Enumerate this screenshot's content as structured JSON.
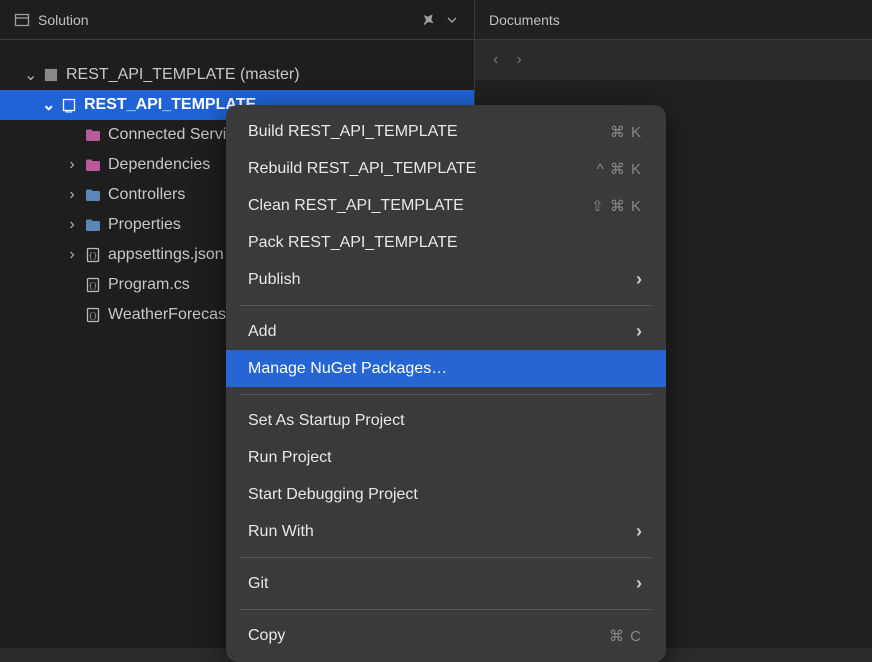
{
  "panels": {
    "solution": {
      "title": "Solution"
    },
    "documents": {
      "title": "Documents"
    }
  },
  "tree": {
    "solution": {
      "label": "REST_API_TEMPLATE (master)"
    },
    "project": {
      "label": "REST_API_TEMPLATE"
    },
    "items": [
      {
        "label": "Connected Services",
        "iconKind": "folder-pink",
        "caret": ""
      },
      {
        "label": "Dependencies",
        "iconKind": "folder-pink",
        "caret": "›"
      },
      {
        "label": "Controllers",
        "iconKind": "folder",
        "caret": "›"
      },
      {
        "label": "Properties",
        "iconKind": "folder",
        "caret": "›"
      },
      {
        "label": "appsettings.json",
        "iconKind": "code",
        "caret": "›"
      },
      {
        "label": "Program.cs",
        "iconKind": "code",
        "caret": ""
      },
      {
        "label": "WeatherForecast.cs",
        "iconKind": "code",
        "caret": ""
      }
    ]
  },
  "contextMenu": {
    "groups": [
      [
        {
          "label": "Build REST_API_TEMPLATE",
          "shortcut": "⌘ K"
        },
        {
          "label": "Rebuild REST_API_TEMPLATE",
          "shortcut": "^ ⌘ K"
        },
        {
          "label": "Clean REST_API_TEMPLATE",
          "shortcut": "⇧ ⌘ K"
        },
        {
          "label": "Pack REST_API_TEMPLATE"
        },
        {
          "label": "Publish",
          "submenu": true
        }
      ],
      [
        {
          "label": "Add",
          "submenu": true
        },
        {
          "label": "Manage NuGet Packages…",
          "highlight": true
        }
      ],
      [
        {
          "label": "Set As Startup Project"
        },
        {
          "label": "Run Project"
        },
        {
          "label": "Start Debugging Project"
        },
        {
          "label": "Run With",
          "submenu": true
        }
      ],
      [
        {
          "label": "Git",
          "submenu": true
        }
      ],
      [
        {
          "label": "Copy",
          "shortcut": "⌘ C"
        }
      ]
    ]
  }
}
